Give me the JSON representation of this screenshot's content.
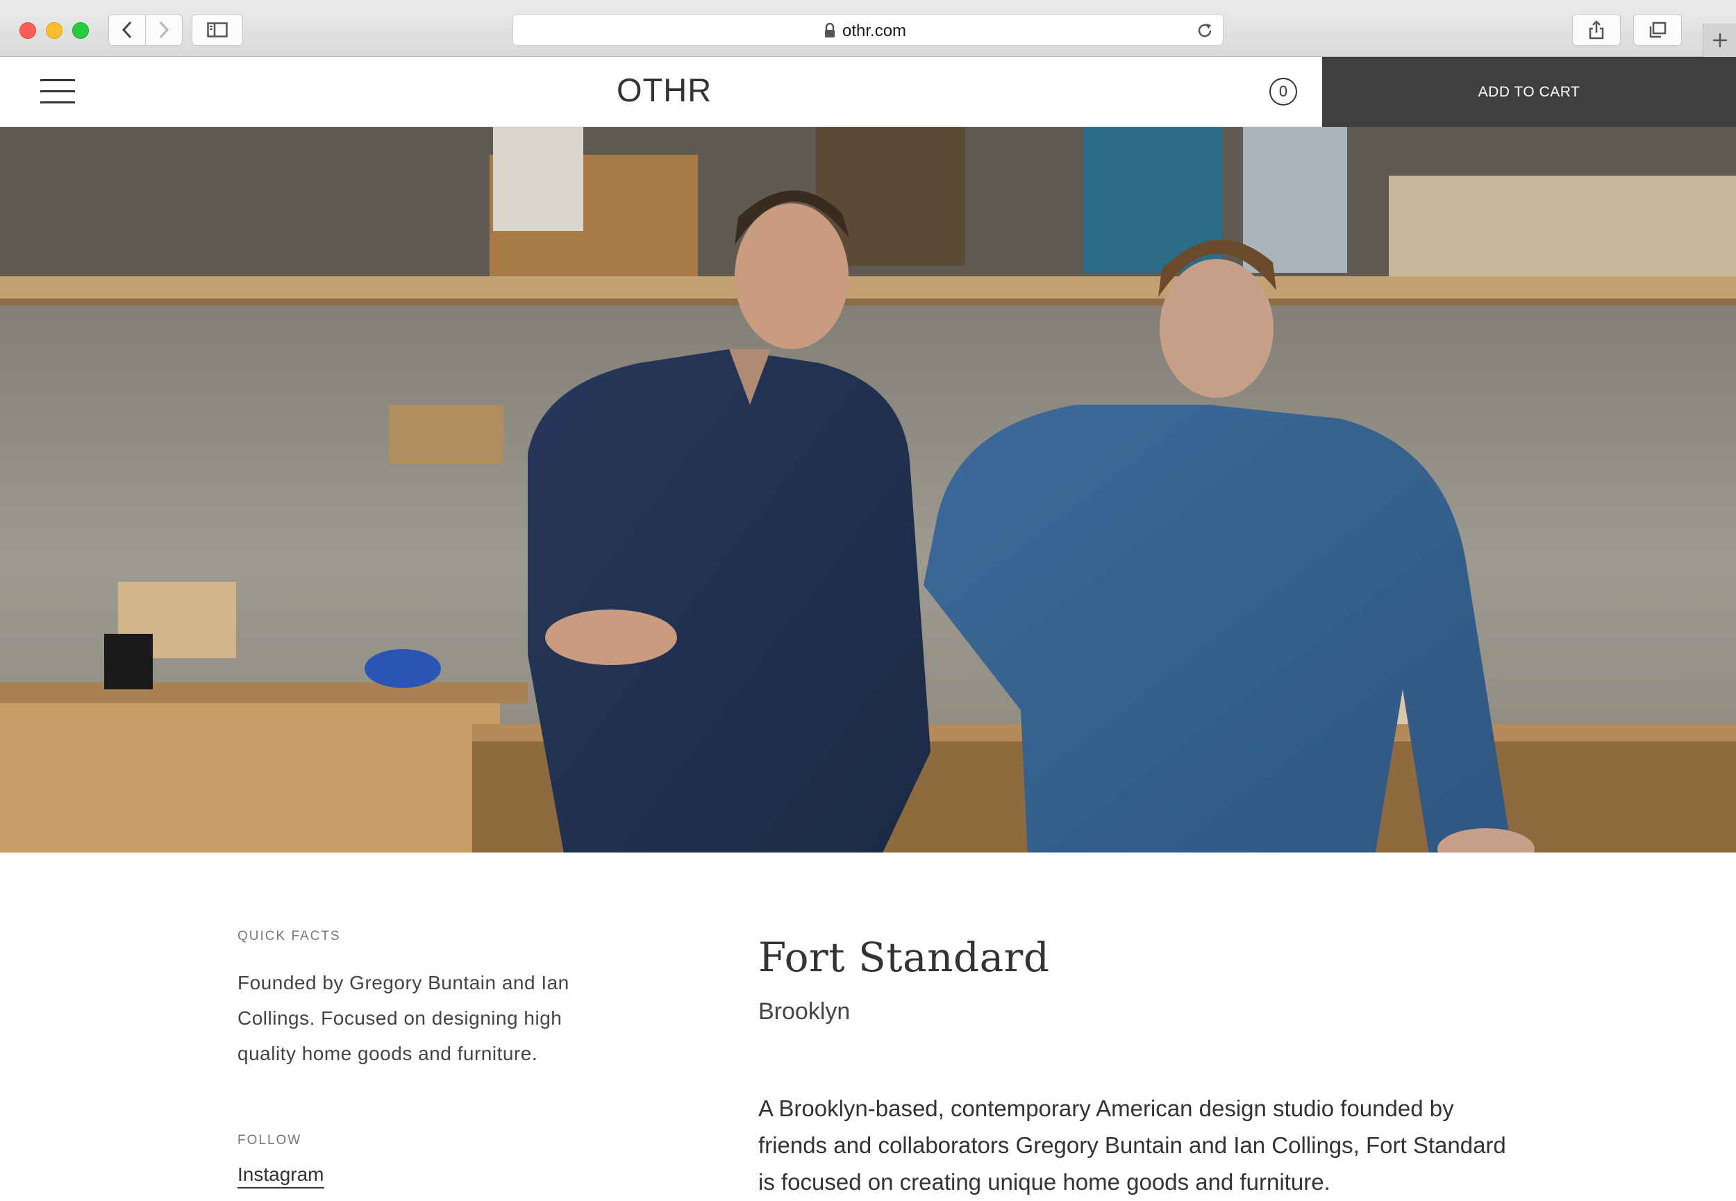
{
  "browser": {
    "url": "othr.com",
    "buttons": {
      "back": "back-icon",
      "forward": "forward-icon",
      "sidebar": "sidebar-icon",
      "share": "share-icon",
      "tabs": "tabs-icon",
      "new_tab": "plus-icon",
      "reload": "reload-icon",
      "lock": "lock-icon"
    }
  },
  "header": {
    "logo": "OTHR",
    "cart_count": "0",
    "add_to_cart": "ADD TO CART",
    "menu_icon": "hamburger-icon"
  },
  "hero": {
    "image": "photo of two men in denim shirts in a woodworking shop"
  },
  "sidebar": {
    "quick_facts_title": "QUICK FACTS",
    "quick_facts_text": "Founded by Gregory Buntain and Ian Collings. Focused on designing high quality home goods and furniture.",
    "follow_title": "FOLLOW",
    "instagram_link": "Instagram"
  },
  "main": {
    "brand_name": "Fort Standard",
    "location": "Brooklyn",
    "description": "A Brooklyn-based, contemporary American design studio founded by friends and collaborators Gregory Buntain and Ian Collings, Fort Standard is focused on creating unique home goods and furniture."
  },
  "colors": {
    "cart_button_bg": "#3f3f3f",
    "text": "#333333",
    "traffic_red": "#fc5f57",
    "traffic_yellow": "#fdbc2e",
    "traffic_green": "#29c940"
  }
}
